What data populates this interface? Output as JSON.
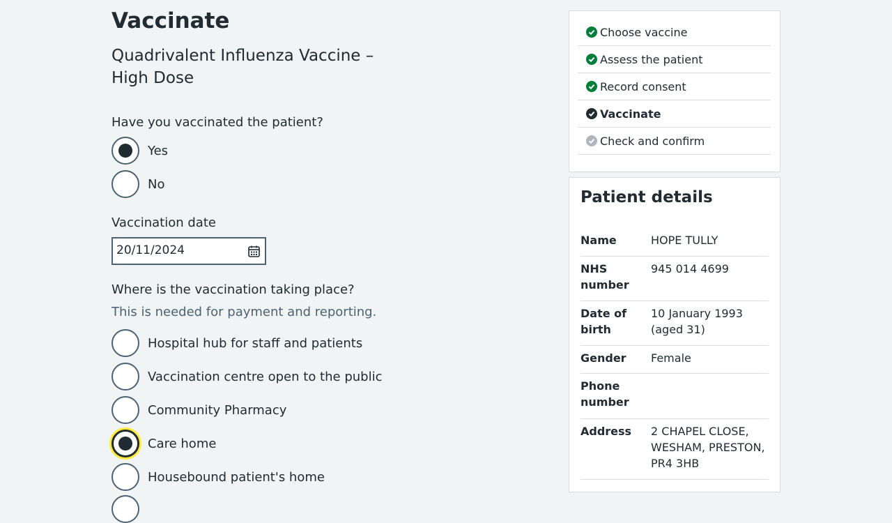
{
  "page": {
    "title": "Vaccinate",
    "vaccine_name": "Quadrivalent Influenza Vaccine – High Dose"
  },
  "vaccinated": {
    "question": "Have you vaccinated the patient?",
    "options": [
      {
        "label": "Yes",
        "checked": true
      },
      {
        "label": "No",
        "checked": false
      }
    ]
  },
  "date": {
    "label": "Vaccination date",
    "value": "20/11/2024"
  },
  "location": {
    "question": "Where is the vaccination taking place?",
    "hint": "This is needed for payment and reporting.",
    "options": [
      {
        "label": "Hospital hub for staff and patients",
        "checked": false
      },
      {
        "label": "Vaccination centre open to the public",
        "checked": false
      },
      {
        "label": "Community Pharmacy",
        "checked": false
      },
      {
        "label": "Care home",
        "checked": true,
        "focused": true
      },
      {
        "label": "Housebound patient's home",
        "checked": false
      }
    ]
  },
  "steps": [
    {
      "label": "Choose vaccine",
      "status": "done"
    },
    {
      "label": "Assess the patient",
      "status": "done"
    },
    {
      "label": "Record consent",
      "status": "done"
    },
    {
      "label": "Vaccinate",
      "status": "current"
    },
    {
      "label": "Check and confirm",
      "status": "todo"
    }
  ],
  "patient": {
    "heading": "Patient details",
    "rows": [
      {
        "key": "Name",
        "value": "HOPE TULLY"
      },
      {
        "key": "NHS number",
        "value": "945 014 4699"
      },
      {
        "key": "Date of birth",
        "value": "10 January 1993 (aged 31)"
      },
      {
        "key": "Gender",
        "value": "Female"
      },
      {
        "key": "Phone number",
        "value": ""
      },
      {
        "key": "Address",
        "value": "2 CHAPEL CLOSE, WESHAM, PRESTON, PR4 3HB"
      }
    ]
  },
  "colors": {
    "done": "#007f3b",
    "current": "#212b32",
    "todo": "#aeb7bd",
    "focus": "#ffeb3b"
  }
}
